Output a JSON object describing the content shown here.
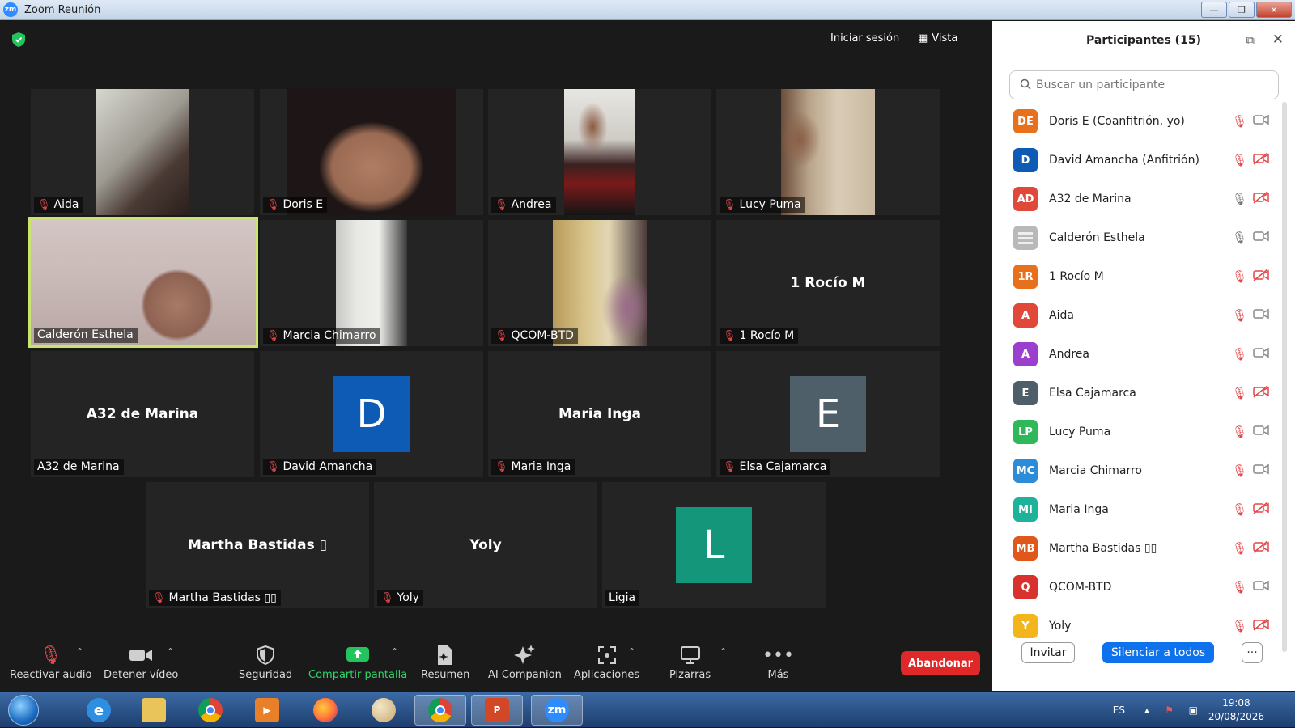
{
  "window": {
    "title": "Zoom Reunión"
  },
  "meeting": {
    "top": {
      "signin": "Iniciar sesión",
      "view": "Vista"
    },
    "tiles": [
      {
        "name": "Aida",
        "muted": true
      },
      {
        "name": "Doris E",
        "muted": true
      },
      {
        "name": "Andrea",
        "muted": true
      },
      {
        "name": "Lucy Puma",
        "muted": true
      },
      {
        "name": "Calderón Esthela",
        "muted": false
      },
      {
        "name": "Marcia Chimarro",
        "muted": true
      },
      {
        "name": "QCOM-BTD",
        "muted": true
      },
      {
        "name": "1 Rocío M",
        "display": "1 Rocío M",
        "muted": true
      },
      {
        "name": "A32 de Marina",
        "display": "A32 de Marina",
        "muted": false
      },
      {
        "name": "David Amancha",
        "avatar": "D",
        "muted": true
      },
      {
        "name": "Maria Inga",
        "display": "Maria Inga",
        "muted": true
      },
      {
        "name": "Elsa Cajamarca",
        "avatar": "E",
        "muted": true
      },
      {
        "name": "Martha Bastidas ▯▯",
        "display": "Martha Bastidas ▯",
        "muted": true
      },
      {
        "name": "Yoly",
        "display": "Yoly",
        "muted": true
      },
      {
        "name": "Ligia",
        "avatar": "L",
        "muted": false
      }
    ]
  },
  "toolbar": {
    "unmute": "Reactivar audio",
    "stop_video": "Detener vídeo",
    "security": "Seguridad",
    "share": "Compartir pantalla",
    "summary": "Resumen",
    "ai": "AI Companion",
    "apps": "Aplicaciones",
    "whiteboards": "Pizarras",
    "more": "Más",
    "leave": "Abandonar"
  },
  "panel": {
    "title": "Participantes (15)",
    "search_placeholder": "Buscar un participante",
    "participants": [
      {
        "initials": "DE",
        "name": "Doris E (Coanfitrión, yo)",
        "color": "#e8701c",
        "mic": "muted",
        "cam": "on"
      },
      {
        "initials": "D",
        "name": "David Amancha (Anfitrión)",
        "color": "#0e5bb5",
        "mic": "muted",
        "cam": "off"
      },
      {
        "initials": "AD",
        "name": "A32 de Marina",
        "color": "#e0483a",
        "mic": "on",
        "cam": "off"
      },
      {
        "initials": "",
        "name": "Calderón Esthela",
        "color": "#b9b9b9",
        "mic": "on",
        "cam": "on"
      },
      {
        "initials": "1R",
        "name": "1 Rocío M",
        "color": "#e8701c",
        "mic": "muted",
        "cam": "off"
      },
      {
        "initials": "A",
        "name": "Aida",
        "color": "#e0483a",
        "mic": "muted",
        "cam": "on"
      },
      {
        "initials": "A",
        "name": "Andrea",
        "color": "#9b3fcf",
        "mic": "muted",
        "cam": "on"
      },
      {
        "initials": "E",
        "name": "Elsa Cajamarca",
        "color": "#4f5f6a",
        "mic": "muted",
        "cam": "off"
      },
      {
        "initials": "LP",
        "name": "Lucy Puma",
        "color": "#2fb85a",
        "mic": "muted",
        "cam": "on"
      },
      {
        "initials": "MC",
        "name": "Marcia Chimarro",
        "color": "#2d8cd8",
        "mic": "muted",
        "cam": "on"
      },
      {
        "initials": "MI",
        "name": "Maria Inga",
        "color": "#1fb29a",
        "mic": "muted",
        "cam": "off"
      },
      {
        "initials": "MB",
        "name": "Martha Bastidas ▯▯",
        "color": "#e0571c",
        "mic": "muted",
        "cam": "off"
      },
      {
        "initials": "Q",
        "name": "QCOM-BTD",
        "color": "#d8322e",
        "mic": "muted",
        "cam": "on"
      },
      {
        "initials": "Y",
        "name": "Yoly",
        "color": "#f2b51c",
        "mic": "muted",
        "cam": "off"
      }
    ],
    "invite": "Invitar",
    "mute_all": "Silenciar a todos",
    "more": "···"
  },
  "taskbar": {
    "lang": "ES",
    "time": "19:08",
    "date": "20/08/2026",
    "zoom_label": "zm",
    "pp_label": "P"
  }
}
